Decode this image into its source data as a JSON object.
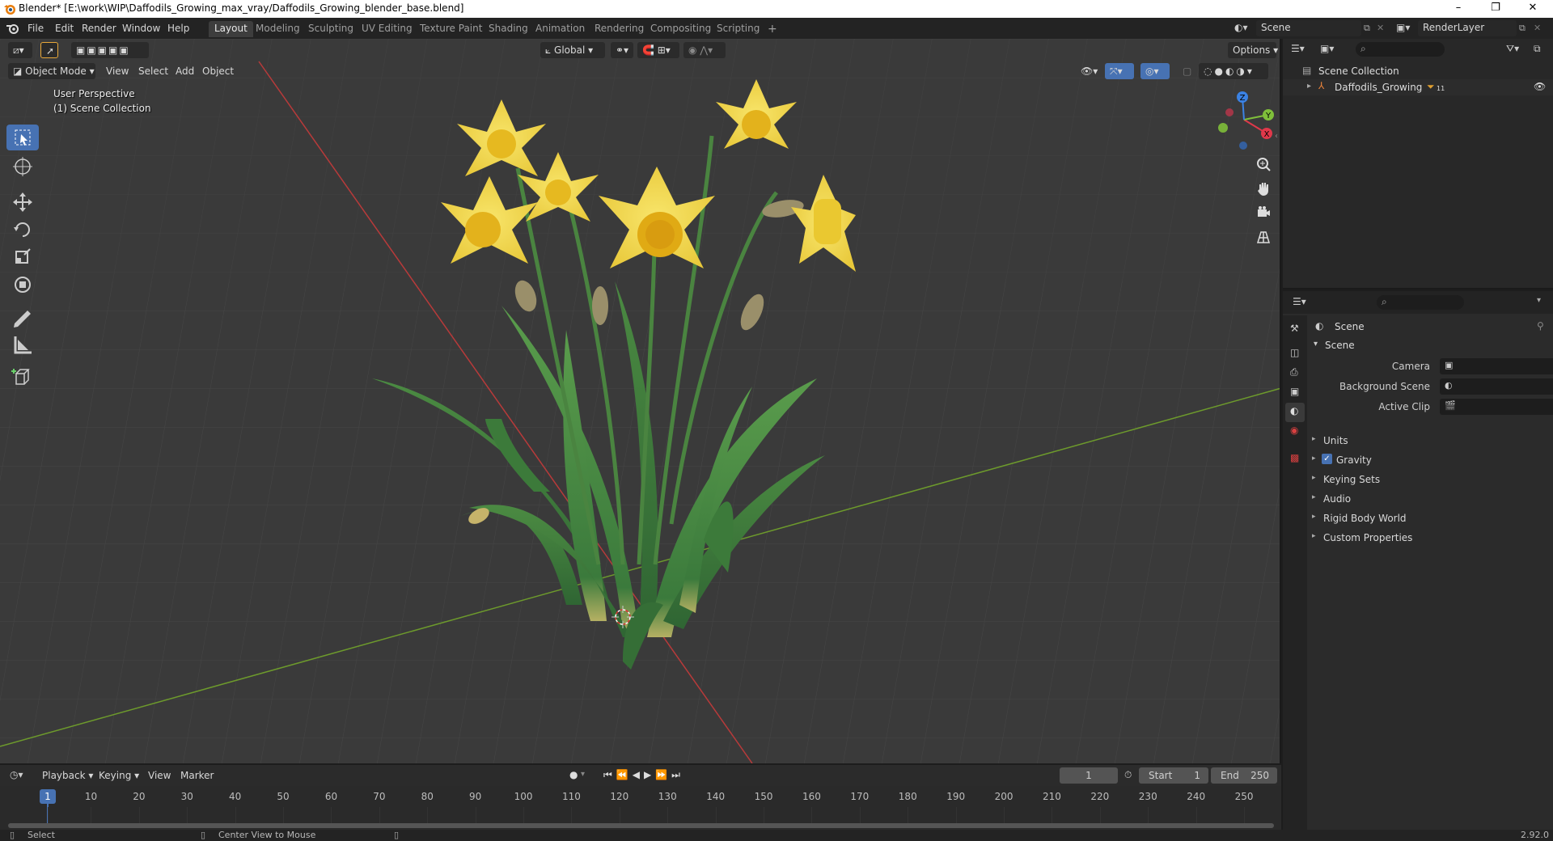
{
  "window": {
    "title": "Blender* [E:\\work\\WIP\\Daffodils_Growing_max_vray/Daffodils_Growing_blender_base.blend]",
    "minimize": "–",
    "maximize": "❐",
    "close": "✕"
  },
  "menus": [
    "File",
    "Edit",
    "Render",
    "Window",
    "Help"
  ],
  "workspaces": [
    {
      "label": "Layout",
      "active": true
    },
    {
      "label": "Modeling"
    },
    {
      "label": "Sculpting"
    },
    {
      "label": "UV Editing"
    },
    {
      "label": "Texture Paint"
    },
    {
      "label": "Shading"
    },
    {
      "label": "Animation"
    },
    {
      "label": "Rendering"
    },
    {
      "label": "Compositing"
    },
    {
      "label": "Scripting"
    },
    {
      "label": "+"
    }
  ],
  "scene_field": "Scene",
  "render_layer_field": "RenderLayer",
  "viewport": {
    "orientation": "Global",
    "options": "Options",
    "mode": "Object Mode",
    "menus": [
      "View",
      "Select",
      "Add",
      "Object"
    ],
    "info_line1": "User Perspective",
    "info_line2": "(1) Scene Collection",
    "gizmo": {
      "x": "X",
      "y": "Y",
      "z": "Z"
    }
  },
  "outliner": {
    "root": "Scene Collection",
    "items": [
      {
        "label": "Daffodils_Growing"
      }
    ],
    "badge": "11"
  },
  "properties": {
    "header": "Scene",
    "section": "Scene",
    "fields": [
      {
        "label": "Camera"
      },
      {
        "label": "Background Scene"
      },
      {
        "label": "Active Clip"
      }
    ],
    "panels": [
      {
        "label": "Units"
      },
      {
        "label": "Gravity",
        "checked": true
      },
      {
        "label": "Keying Sets"
      },
      {
        "label": "Audio"
      },
      {
        "label": "Rigid Body World"
      },
      {
        "label": "Custom Properties"
      }
    ]
  },
  "timeline": {
    "menus": [
      "Playback",
      "Keying",
      "View",
      "Marker"
    ],
    "current_frame": "1",
    "start_label": "Start",
    "start": "1",
    "end_label": "End",
    "end": "250",
    "ticks": [
      "1",
      "10",
      "20",
      "30",
      "40",
      "50",
      "60",
      "70",
      "80",
      "90",
      "100",
      "110",
      "120",
      "130",
      "140",
      "150",
      "160",
      "170",
      "180",
      "190",
      "200",
      "210",
      "220",
      "230",
      "240",
      "250"
    ]
  },
  "statusbar": {
    "left": "Select",
    "middle": "Center View to Mouse",
    "version": "2.92.0"
  },
  "colors": {
    "accent": "#4772b3",
    "x_axis": "#c23a3a",
    "y_axis": "#6a9a2a",
    "petal": "#f2d94a",
    "leaf": "#3f7a3a"
  }
}
